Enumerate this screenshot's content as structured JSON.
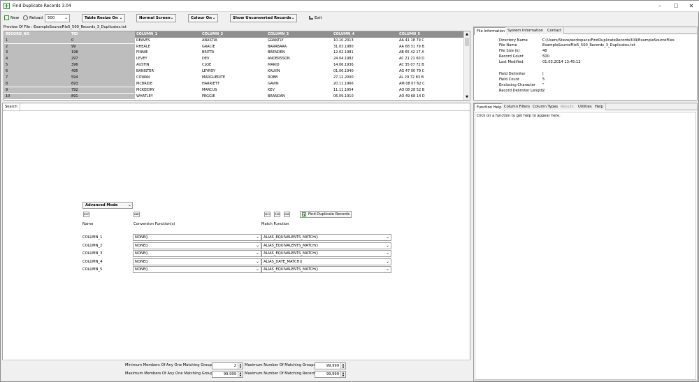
{
  "window": {
    "title": "Find Duplicate Records 3.04"
  },
  "toolbar": {
    "new_label": "New",
    "reload_label": "Reload",
    "reload_count": "500",
    "table_resize": "Table Resize On",
    "screen_mode": "Normal Screen",
    "colour": "Colour On",
    "show_unconverted": "Show Unconverted Records",
    "exit_label": "Exit"
  },
  "preview": {
    "label": "Preview Of File : ExampleSourceFile5_500_Records_3_Duplicates.txt",
    "headers": [
      "RECORD_NO",
      "TID",
      "COLUMN_1",
      "COLUMN_2",
      "COLUMN_3",
      "COLUMN_4",
      "COLUMN_5"
    ],
    "rows": [
      [
        "1",
        "0",
        "REAVES",
        "ANASTIA",
        "GRANTLY",
        "10.10.2013",
        "AA 41 18 79 C"
      ],
      [
        "2",
        "99",
        "RHEALE",
        "GRACIE",
        "BARABARA",
        "31.03.1980",
        "AA 68 31 79 B"
      ],
      [
        "3",
        "198",
        "FINNIE",
        "BRITTA",
        "BRENDEN",
        "12.02.1981",
        "AB 65 42 17 A"
      ],
      [
        "4",
        "297",
        "LEVEY",
        "DEV",
        "ANDERSSON",
        "24.04.1982",
        "AC 21 21 60 D"
      ],
      [
        "5",
        "396",
        "AUSTIN",
        "CLOE",
        "MARIO",
        "14.06.1936",
        "AC 35 07 72 B"
      ],
      [
        "6",
        "495",
        "BANISTER",
        "LEYROY",
        "KALVIN",
        "01.06.1940",
        "AG 47 00 79 C"
      ],
      [
        "7",
        "594",
        "COWAN",
        "MARGUERITE",
        "ROBB",
        "27.12.2000",
        "AL 29 72 83 B"
      ],
      [
        "8",
        "693",
        "MCBRIDE",
        "HARRIETT",
        "GAVIN",
        "20.11.1966",
        "AM 08 07 62 C"
      ],
      [
        "9",
        "792",
        "MCKEIDRY",
        "MARCUS",
        "KEV",
        "11.11.1954",
        "AO 08 28 52 B"
      ],
      [
        "10",
        "891",
        "WHATLEY",
        "PEGGIE",
        "BRANDAN",
        "06.09.1910",
        "AO 49 68 14 D"
      ]
    ]
  },
  "right_tabs": [
    "File Information",
    "System Information",
    "Contact"
  ],
  "file_info": {
    "labels": [
      "Directory Name",
      "File Name",
      "File Size (k)",
      "Record Count",
      "Last Modified",
      "Field Delimiter",
      "Field Count",
      "Enclosing Character",
      "Record Delimiter Length"
    ],
    "values": [
      "C:/Users/Steve/workspace/FindDuplicateRecords304/ExampleSourceFiles",
      "ExampleSourceFile5_500_Records_3_Duplicates.txt",
      "48",
      "500",
      "01.03.2014 13:45:12",
      "|",
      "5",
      "\"",
      "2"
    ]
  },
  "search": {
    "tab_label": "Search",
    "mode": "Advanced Mode",
    "btn_small_1": "EDF",
    "btn_small_2": "BBF",
    "btn_small_3": "MCI",
    "btn_small_4": "RED",
    "btn_small_5": "EBE",
    "find_button": "Find Duplicate Records",
    "col_name_header": "Name",
    "col_conv_header": "Conversion Function(s)",
    "col_match_header": "Match Function",
    "rows": [
      {
        "name": "COLUMN_1",
        "conv": "NONE()",
        "match": "ALIAS_EQUIVALENTS_MATCH()"
      },
      {
        "name": "COLUMN_2",
        "conv": "NONE()",
        "match": "ALIAS_EQUIVALENTS_MATCH()"
      },
      {
        "name": "COLUMN_3",
        "conv": "NONE()",
        "match": "ALIAS_EQUIVALENTS_MATCH()"
      },
      {
        "name": "COLUMN_4",
        "conv": "NONE()",
        "match": "ALIAS_DATE_MATCH()"
      },
      {
        "name": "COLUMN_5",
        "conv": "NONE()",
        "match": "ALIAS_EQUIVALENTS_MATCH()"
      }
    ]
  },
  "limits": {
    "min_members_label": "Minimum Members Of Any One Matching Group",
    "min_members_value": "2",
    "max_members_label": "Maximum Members Of Any One Matching Group",
    "max_members_value": "99,999",
    "max_groups_label": "Maximum Number Of Matching Groups",
    "max_groups_value": "99,999",
    "max_records_label": "Maximum Number Of Matching Records",
    "max_records_value": "99,999"
  },
  "help_tabs": [
    "Function Help",
    "Column Filters",
    "Column Types",
    "Results",
    "Utilities",
    "Help"
  ],
  "help": {
    "message": "Click on a function to get help to appear here."
  }
}
